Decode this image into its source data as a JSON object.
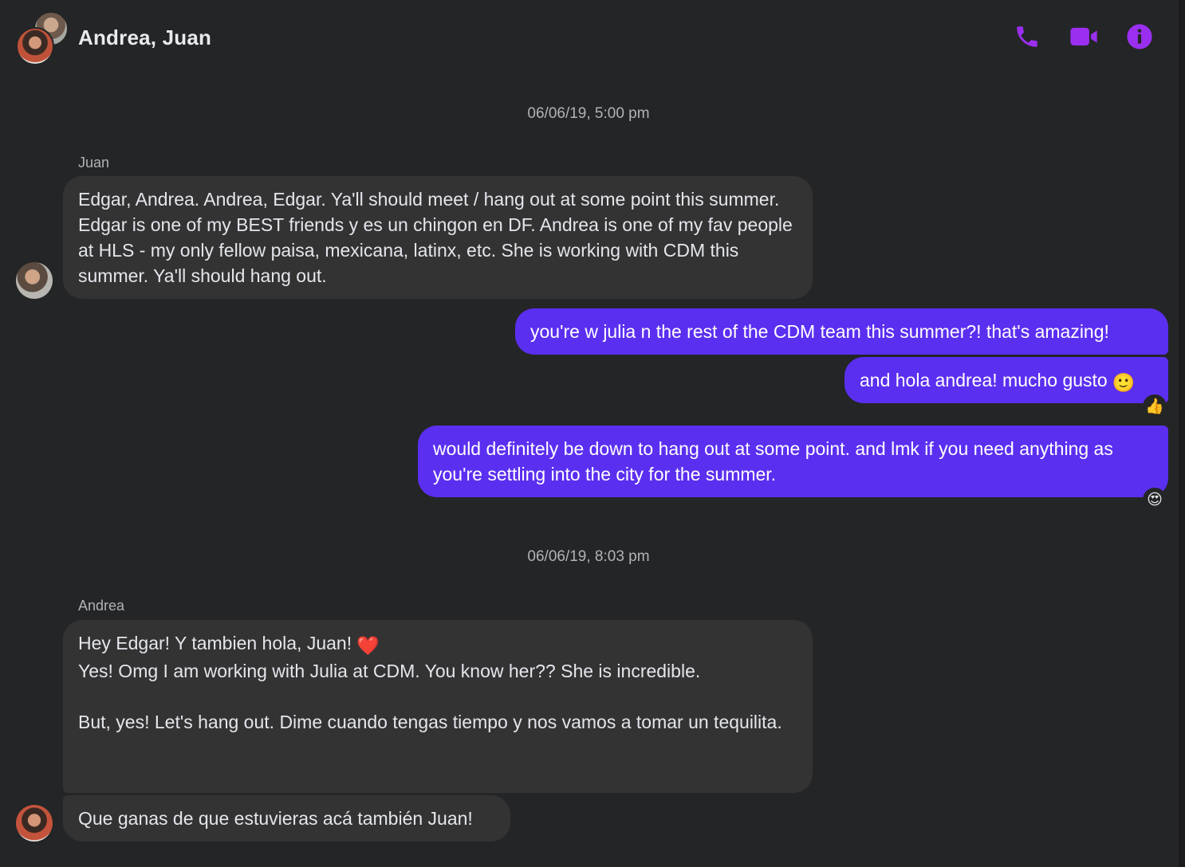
{
  "header": {
    "title": "Andrea, Juan",
    "accent_color": "#9b2ff0",
    "actions": [
      {
        "icon": "phone-icon"
      },
      {
        "icon": "video-camera-icon"
      },
      {
        "icon": "info-icon"
      }
    ]
  },
  "timestamps": [
    "06/06/19, 5:00 pm",
    "06/06/19, 8:03 pm"
  ],
  "senders": {
    "juan": "Juan",
    "andrea": "Andrea"
  },
  "messages": {
    "juan_1": "Edgar, Andrea. Andrea, Edgar. Ya'll should meet / hang out at some point this summer. Edgar is one of my BEST friends y es un chingon en DF. Andrea is one of my fav people at HLS - my only fellow paisa, mexicana, latinx, etc. She is working with CDM this summer. Ya'll should hang out.",
    "me_1": "you're w julia n the rest of the CDM team this summer?! that's amazing!",
    "me_2": "and hola andrea! mucho gusto",
    "me_2_emoji": "🙂",
    "me_3": "would definitely be down to hang out at some point. and lmk if you need anything as you're settling into the city for the summer.",
    "andrea_1_line1": "Hey Edgar! Y tambien hola, Juan!",
    "andrea_1_emoji": "❤️",
    "andrea_1_rest": "Yes! Omg I am working with Julia at CDM. You know her?? She is incredible.\n\nBut, yes! Let's hang out. Dime cuando tengas tiempo y nos vamos a tomar un tequilita.",
    "andrea_2": "Que ganas de que estuvieras acá también Juan!"
  },
  "reactions": {
    "me_2": "👍",
    "me_3": "😍"
  },
  "colors": {
    "background": "#242526",
    "incoming_bubble": "#333334",
    "outgoing_bubble": "#5b2ff0"
  }
}
